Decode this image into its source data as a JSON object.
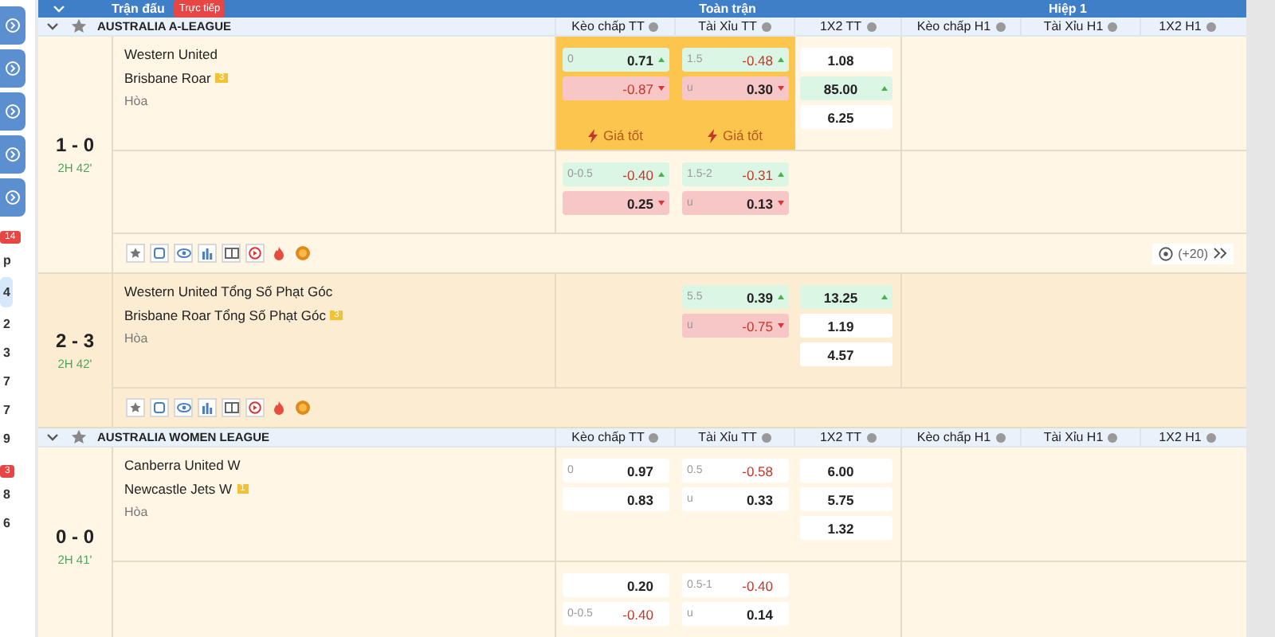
{
  "header": {
    "match_label": "Trận đấu",
    "live_badge": "Trực tiếp",
    "groups": [
      "Toàn trận",
      "Hiệp 1"
    ]
  },
  "sidebar": [
    {
      "kind": "button"
    },
    {
      "kind": "button"
    },
    {
      "kind": "button"
    },
    {
      "kind": "button"
    },
    {
      "kind": "button"
    },
    {
      "kind": "badge",
      "text": "14"
    },
    {
      "kind": "count",
      "text": "p",
      "selected": false
    },
    {
      "kind": "count",
      "text": "4",
      "selected": true
    },
    {
      "kind": "count",
      "text": "2",
      "selected": false
    },
    {
      "kind": "count",
      "text": "3",
      "selected": false
    },
    {
      "kind": "count",
      "text": "7",
      "selected": false
    },
    {
      "kind": "count",
      "text": "7",
      "selected": false
    },
    {
      "kind": "count",
      "text": "9",
      "selected": false
    },
    {
      "kind": "badge",
      "text": "3"
    },
    {
      "kind": "count",
      "text": "8",
      "selected": false
    },
    {
      "kind": "count",
      "text": "6",
      "selected": false
    }
  ],
  "leagues": [
    {
      "name": "AUSTRALIA A-LEAGUE",
      "columns": [
        "Kèo chấp TT",
        "Tài Xỉu TT",
        "1X2 TT",
        "Kèo chấp H1",
        "Tài Xỉu H1",
        "1X2 H1"
      ],
      "matches": [
        {
          "score": "1 - 0",
          "time": "2H 42'",
          "highlighted": false,
          "more": "(+20)",
          "rows": [
            {
              "teams": [
                "Western United",
                "Brisbane Roar"
              ],
              "card": "3",
              "draw": "Hòa",
              "hdp": {
                "best_label": "Giá tốt",
                "odds": [
                  {
                    "line": "0",
                    "value": "0.71",
                    "rising": true,
                    "falling": false
                  },
                  {
                    "value": "-0.87",
                    "rising": false,
                    "falling": true
                  }
                ]
              },
              "ou": {
                "best_label": "Giá tốt",
                "odds": [
                  {
                    "line": "1.5",
                    "value": "-0.48",
                    "rising": true,
                    "falling": false
                  },
                  {
                    "line": "u",
                    "value": "0.30",
                    "rising": false,
                    "falling": true
                  }
                ]
              },
              "x12": [
                {
                  "value": "1.08",
                  "rising": false,
                  "falling": false
                },
                {
                  "value": "85.00",
                  "rising": true,
                  "falling": false
                },
                {
                  "value": "6.25",
                  "rising": false,
                  "falling": false
                }
              ]
            },
            {
              "hdp": {
                "odds": [
                  {
                    "line": "0-0.5",
                    "value": "-0.40",
                    "rising": true,
                    "falling": false
                  },
                  {
                    "value": "0.25",
                    "rising": false,
                    "falling": true
                  }
                ]
              },
              "ou": {
                "odds": [
                  {
                    "line": "1.5-2",
                    "value": "-0.31",
                    "rising": true,
                    "falling": false
                  },
                  {
                    "line": "u",
                    "value": "0.13",
                    "rising": false,
                    "falling": true
                  }
                ]
              }
            }
          ]
        },
        {
          "score": "2 - 3",
          "time": "2H 42'",
          "highlighted": true,
          "rows": [
            {
              "teams": [
                "Western United Tổng Số Phạt Góc",
                "Brisbane Roar Tổng Số Phạt Góc"
              ],
              "card": "3",
              "draw": "Hòa",
              "ou": {
                "odds": [
                  {
                    "line": "5.5",
                    "value": "0.39",
                    "rising": true,
                    "falling": false
                  },
                  {
                    "line": "u",
                    "value": "-0.75",
                    "rising": false,
                    "falling": true
                  }
                ]
              },
              "x12": [
                {
                  "value": "13.25",
                  "rising": true,
                  "falling": false
                },
                {
                  "value": "1.19",
                  "rising": false,
                  "falling": false
                },
                {
                  "value": "4.57",
                  "rising": false,
                  "falling": false
                }
              ]
            }
          ]
        }
      ]
    },
    {
      "name": "AUSTRALIA WOMEN LEAGUE",
      "columns": [
        "Kèo chấp TT",
        "Tài Xỉu TT",
        "1X2 TT",
        "Kèo chấp H1",
        "Tài Xỉu H1",
        "1X2 H1"
      ],
      "matches": [
        {
          "score": "0 - 0",
          "time": "2H 41'",
          "highlighted": false,
          "rows": [
            {
              "teams": [
                "Canberra United W",
                "Newcastle Jets W"
              ],
              "card": "1",
              "draw": "Hòa",
              "hdp": {
                "odds": [
                  {
                    "line": "0",
                    "value": "0.97",
                    "rising": false,
                    "falling": false
                  },
                  {
                    "value": "0.83",
                    "rising": false,
                    "falling": false
                  }
                ]
              },
              "ou": {
                "odds": [
                  {
                    "line": "0.5",
                    "value": "-0.58",
                    "rising": false,
                    "falling": false
                  },
                  {
                    "line": "u",
                    "value": "0.33",
                    "rising": false,
                    "falling": false
                  }
                ]
              },
              "x12": [
                {
                  "value": "6.00",
                  "rising": false,
                  "falling": false
                },
                {
                  "value": "5.75",
                  "rising": false,
                  "falling": false
                },
                {
                  "value": "1.32",
                  "rising": false,
                  "falling": false
                }
              ]
            },
            {
              "hdp": {
                "odds": [
                  {
                    "value": "0.20",
                    "rising": false,
                    "falling": false
                  },
                  {
                    "line": "0-0.5",
                    "value": "-0.40",
                    "rising": false,
                    "falling": false
                  }
                ]
              },
              "ou": {
                "odds": [
                  {
                    "line": "0.5-1",
                    "value": "-0.40",
                    "rising": false,
                    "falling": false
                  },
                  {
                    "line": "u",
                    "value": "0.14",
                    "rising": false,
                    "falling": false
                  }
                ]
              }
            }
          ]
        }
      ]
    }
  ]
}
